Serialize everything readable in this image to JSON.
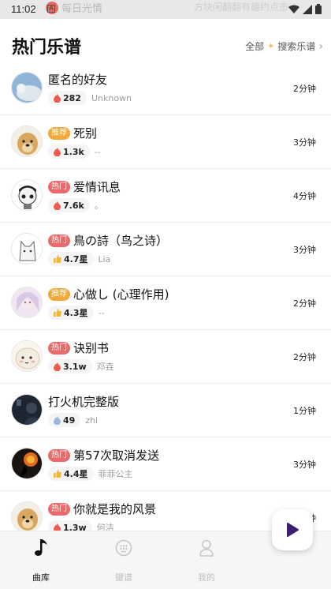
{
  "status_bar": {
    "time": "11:02",
    "faded_text": "每日光情",
    "faded_text_right": "方块闲翻翻有趣约点击"
  },
  "header": {
    "title": "热门乐谱",
    "all_label": "全部",
    "search_label": "搜索乐谱"
  },
  "songs": [
    {
      "name": "匿名的好友",
      "tag": "",
      "metric": "282",
      "metric_icon": "flame-icon",
      "artist": "Unknown",
      "duration": "2分钟"
    },
    {
      "name": "死别",
      "tag": "推荐",
      "metric": "1.3k",
      "metric_icon": "flame-icon",
      "artist": "--",
      "duration": "3分钟"
    },
    {
      "name": "爱情讯息",
      "tag": "热门",
      "metric": "7.6k",
      "metric_icon": "flame-icon",
      "artist": "。",
      "duration": "4分钟"
    },
    {
      "name": "鳥の詩（鸟之诗）",
      "tag": "热门",
      "metric": "4.7星",
      "metric_icon": "thumbs-up-icon",
      "artist": "Lia",
      "duration": "3分钟"
    },
    {
      "name": "心做し (心理作用)",
      "tag": "推荐",
      "metric": "4.3星",
      "metric_icon": "thumbs-up-icon",
      "artist": "--",
      "duration": "2分钟"
    },
    {
      "name": "诀别书",
      "tag": "热门",
      "metric": "3.1w",
      "metric_icon": "flame-icon",
      "artist": "邓垚",
      "duration": "2分钟"
    },
    {
      "name": "打火机完整版",
      "tag": "",
      "metric": "49",
      "metric_icon": "droplet-icon",
      "artist": "zhi",
      "duration": "1分钟"
    },
    {
      "name": "第57次取消发送",
      "tag": "热门",
      "metric": "4.4星",
      "metric_icon": "thumbs-up-icon",
      "artist": "菲菲公主",
      "duration": "3分钟"
    },
    {
      "name": "你就是我的风景",
      "tag": "热门",
      "metric": "1.3w",
      "metric_icon": "flame-icon",
      "artist": "何洁",
      "duration": "2分钟"
    }
  ],
  "tabs": [
    {
      "label": "曲库",
      "icon": "music-note-icon",
      "active": true
    },
    {
      "label": "键谱",
      "icon": "keypad-icon",
      "active": false
    },
    {
      "label": "我的",
      "icon": "person-icon",
      "active": false
    }
  ],
  "colors": {
    "hot_tag": "#e96a6a",
    "recommend_tag": "#f0a93a",
    "flame": "#ef5b4f",
    "thumb": "#f2b63a",
    "droplet": "#9fb6e0",
    "play_accent": "#3a1f6e"
  }
}
